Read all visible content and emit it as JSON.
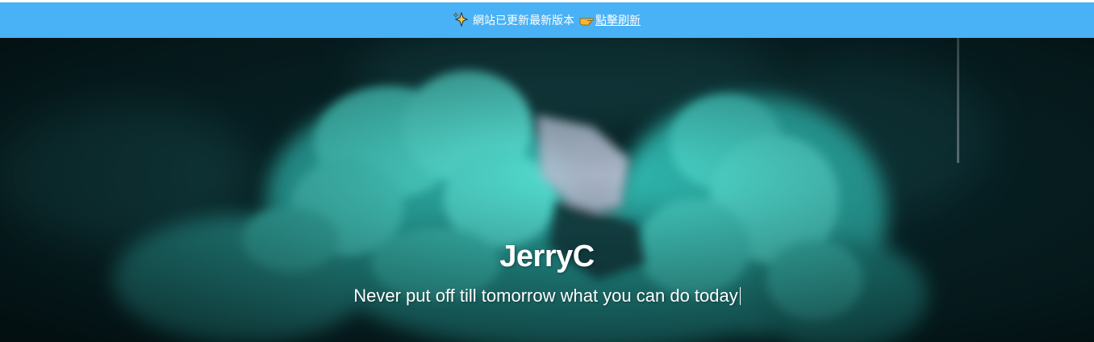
{
  "notice": {
    "icon": "sparkles-icon",
    "text": "網站已更新最新版本",
    "link_icon": "pointing-hand-icon",
    "link_label": "點擊刷新",
    "background": "#49b1f5"
  },
  "hero": {
    "title": "JerryC",
    "subtitle": "Never put off till tomorrow what you can do today",
    "background_image": "teal-smoke-photo",
    "smoke_color": "#3fd9cc",
    "dark_color": "#05191c"
  }
}
